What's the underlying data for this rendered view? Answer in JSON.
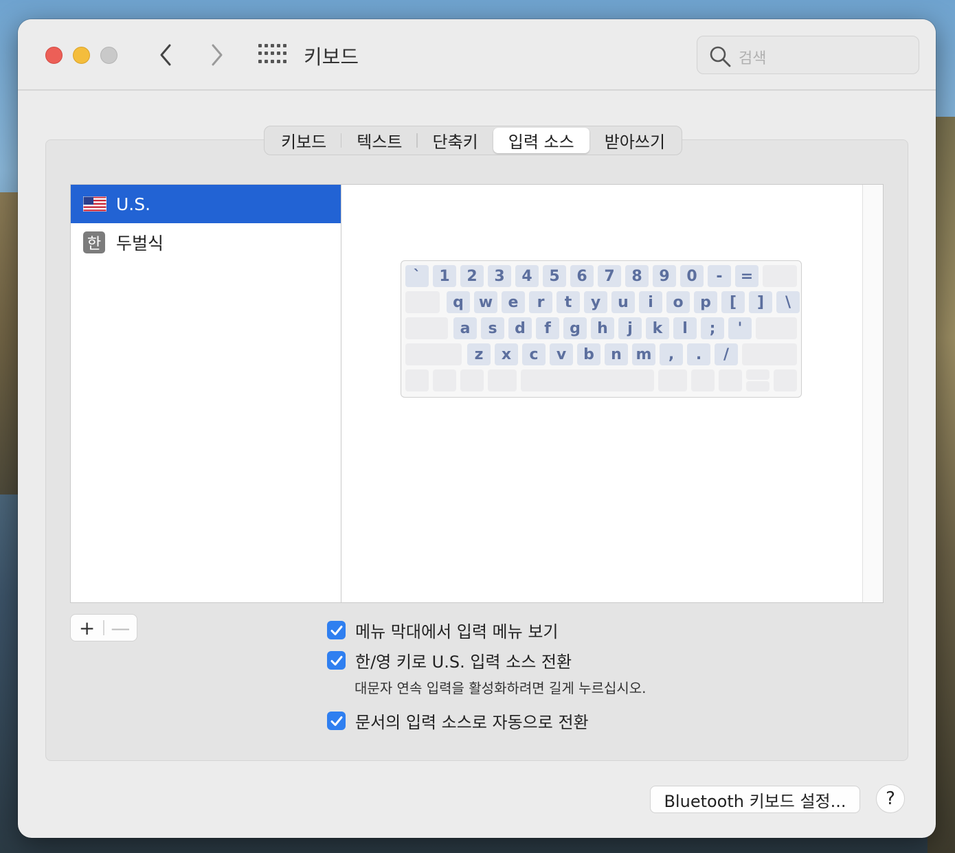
{
  "window": {
    "title": "키보드"
  },
  "search": {
    "placeholder": "검색"
  },
  "tabs": [
    {
      "label": "키보드",
      "active": false
    },
    {
      "label": "텍스트",
      "active": false
    },
    {
      "label": "단축키",
      "active": false
    },
    {
      "label": "입력 소스",
      "active": true
    },
    {
      "label": "받아쓰기",
      "active": false
    }
  ],
  "input_sources": [
    {
      "label": "U.S.",
      "icon": "us-flag-icon",
      "selected": true
    },
    {
      "label": "두벌식",
      "icon": "hangul-icon",
      "badge": "한",
      "selected": false
    }
  ],
  "keyboard_preview": {
    "rows": [
      [
        "`",
        "1",
        "2",
        "3",
        "4",
        "5",
        "6",
        "7",
        "8",
        "9",
        "0",
        "-",
        "="
      ],
      [
        "q",
        "w",
        "e",
        "r",
        "t",
        "y",
        "u",
        "i",
        "o",
        "p",
        "[",
        "]",
        "\\"
      ],
      [
        "a",
        "s",
        "d",
        "f",
        "g",
        "h",
        "j",
        "k",
        "l",
        ";",
        "'"
      ],
      [
        "z",
        "x",
        "c",
        "v",
        "b",
        "n",
        "m",
        ",",
        ".",
        "/"
      ]
    ]
  },
  "list_controls": {
    "add_label": "+",
    "remove_label": "—"
  },
  "options": {
    "show_menu": {
      "label": "메뉴 막대에서 입력 메뉴 보기",
      "checked": true
    },
    "han_switch": {
      "label": "한/영 키로 U.S. 입력 소스 전환",
      "checked": true,
      "hint": "대문자 연속 입력을 활성화하려면 길게 누르십시오."
    },
    "auto_switch": {
      "label": "문서의 입력 소스로 자동으로 전환",
      "checked": true
    }
  },
  "footer": {
    "bluetooth_label": "Bluetooth 키보드 설정...",
    "help_label": "?"
  },
  "colors": {
    "selection": "#2263d4",
    "checkbox": "#2f7ff0",
    "key_text": "#5c6f9e",
    "key_bg": "#dde3ee"
  }
}
